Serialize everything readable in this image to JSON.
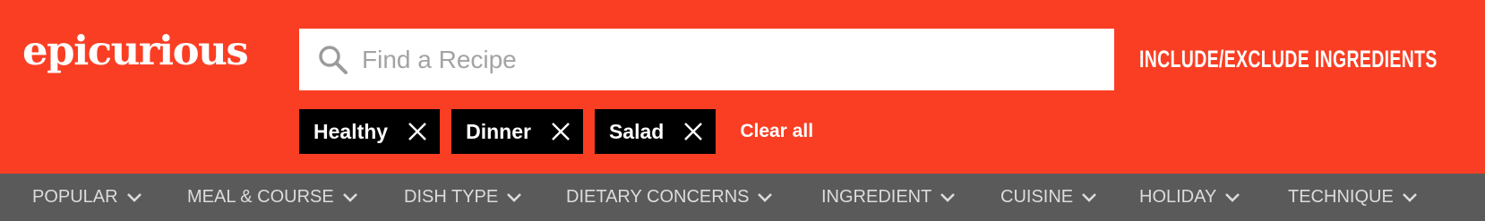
{
  "header": {
    "logo_text": "epicurious",
    "background_color": "#fa3e23",
    "include_exclude_label": "INCLUDE/EXCLUDE INGREDIENTS"
  },
  "search": {
    "placeholder": "Find a Recipe",
    "value": "",
    "icon": "search-icon"
  },
  "filters": {
    "chips": [
      {
        "label": "Healthy",
        "icon": "close-icon"
      },
      {
        "label": "Dinner",
        "icon": "close-icon"
      },
      {
        "label": "Salad",
        "icon": "close-icon"
      }
    ],
    "clear_all_label": "Clear all"
  },
  "nav": {
    "background_color": "#5a5a5a",
    "items": [
      {
        "label": "POPULAR",
        "icon": "chevron-down-icon"
      },
      {
        "label": "MEAL & COURSE",
        "icon": "chevron-down-icon"
      },
      {
        "label": "DISH TYPE",
        "icon": "chevron-down-icon"
      },
      {
        "label": "DIETARY CONCERNS",
        "icon": "chevron-down-icon"
      },
      {
        "label": "INGREDIENT",
        "icon": "chevron-down-icon"
      },
      {
        "label": "CUISINE",
        "icon": "chevron-down-icon"
      },
      {
        "label": "HOLIDAY",
        "icon": "chevron-down-icon"
      },
      {
        "label": "TECHNIQUE",
        "icon": "chevron-down-icon"
      }
    ]
  }
}
